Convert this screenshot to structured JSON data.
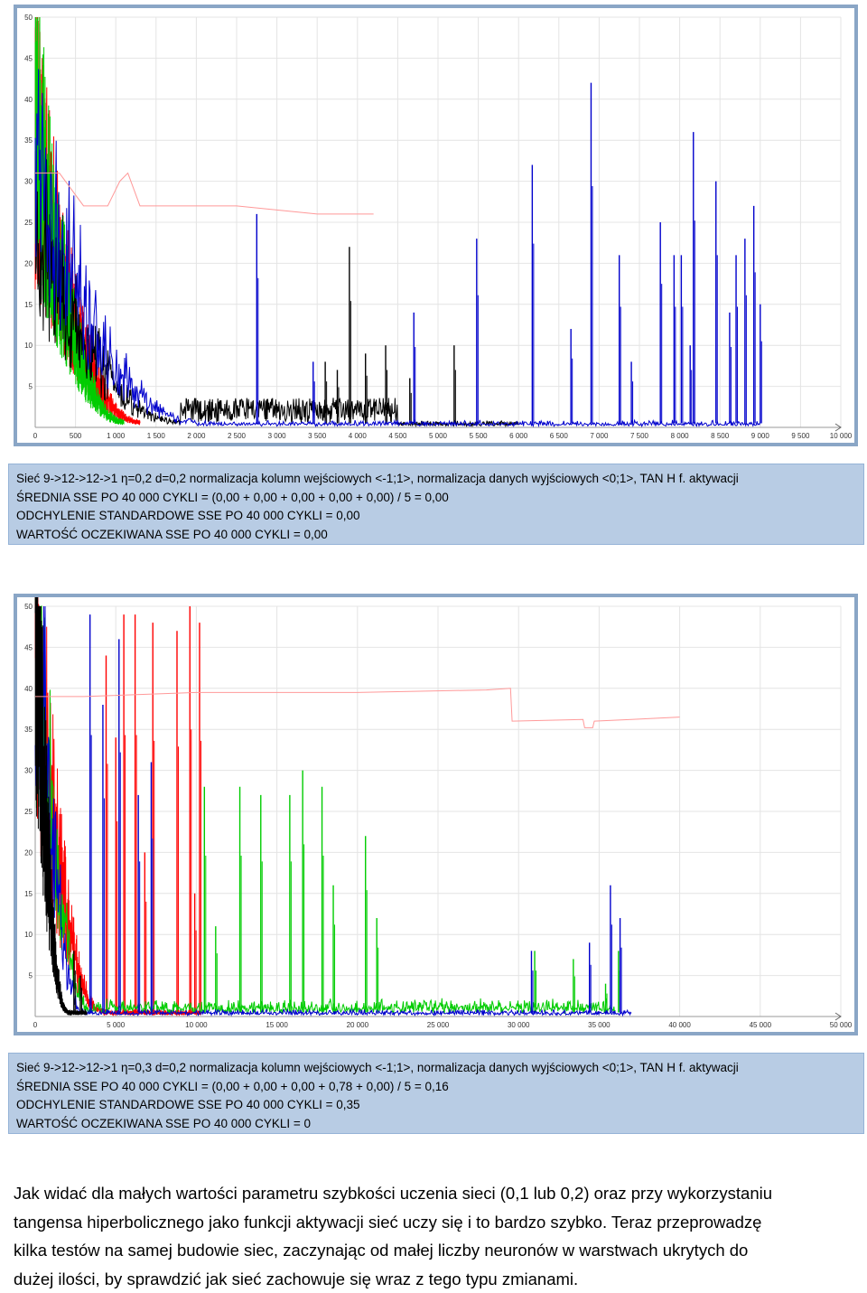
{
  "charts_meta": {
    "colors": {
      "frame": "#8aa6c6",
      "caption_bg": "#b8cce4",
      "grid": "#e4e4e4"
    }
  },
  "chart_data": [
    {
      "type": "line",
      "title": "",
      "xlabel": "",
      "ylabel": "",
      "xlim": [
        0,
        10000
      ],
      "ylim": [
        0,
        50
      ],
      "x_ticks": [
        "0",
        "500",
        "1 000",
        "1 500",
        "2 000",
        "2 500",
        "3 000",
        "3 500",
        "4 000",
        "4 500",
        "5 000",
        "5 500",
        "6 000",
        "6 500",
        "7 000",
        "7 500",
        "8 000",
        "8 500",
        "9 000",
        "9 500",
        "10 000"
      ],
      "y_ticks": [
        "5",
        "10",
        "15",
        "20",
        "25",
        "30",
        "35",
        "40",
        "45",
        "50"
      ],
      "grid": true,
      "series": [
        {
          "color": "#ff0000",
          "decay_end": 1300,
          "decay_start": 30,
          "last": 1300,
          "spikes": []
        },
        {
          "color": "#00cc00",
          "decay_end": 1100,
          "decay_start": 32,
          "last": 1100,
          "spikes": []
        },
        {
          "color": "#000000",
          "decay_end": 1800,
          "decay_start": 22,
          "last": 6000,
          "noise_mid": 3,
          "spikes": [
            [
              3900,
              22
            ],
            [
              4350,
              10
            ],
            [
              5200,
              10
            ],
            [
              3750,
              7
            ],
            [
              4650,
              6
            ],
            [
              3600,
              8
            ],
            [
              4100,
              9
            ]
          ]
        },
        {
          "color": "#0000cc",
          "decay_end": 2000,
          "decay_start": 28,
          "last": 9000,
          "spikes": [
            [
              2750,
              26
            ],
            [
              3450,
              8
            ],
            [
              4700,
              14
            ],
            [
              5480,
              23
            ],
            [
              6170,
              32
            ],
            [
              6650,
              12
            ],
            [
              6900,
              42
            ],
            [
              7250,
              21
            ],
            [
              7760,
              25
            ],
            [
              7930,
              21
            ],
            [
              8020,
              21
            ],
            [
              8170,
              36
            ],
            [
              8450,
              30
            ],
            [
              8700,
              21
            ],
            [
              8810,
              23
            ],
            [
              8920,
              27
            ],
            [
              9000,
              15
            ],
            [
              8620,
              14
            ],
            [
              8130,
              10
            ],
            [
              7400,
              8
            ]
          ]
        },
        {
          "color": "#ff9999",
          "line": [
            [
              0,
              31
            ],
            [
              300,
              31
            ],
            [
              600,
              27
            ],
            [
              900,
              27
            ],
            [
              1050,
              30
            ],
            [
              1150,
              31
            ],
            [
              1300,
              27
            ],
            [
              2500,
              27
            ],
            [
              3500,
              26
            ],
            [
              4200,
              26
            ]
          ]
        }
      ]
    },
    {
      "type": "line",
      "title": "",
      "xlabel": "",
      "ylabel": "",
      "xlim": [
        0,
        50000
      ],
      "ylim": [
        0,
        50
      ],
      "x_ticks": [
        "0",
        "5 000",
        "10 000",
        "15 000",
        "20 000",
        "25 000",
        "30 000",
        "35 000",
        "40 000",
        "45 000",
        "50 000"
      ],
      "y_ticks": [
        "5",
        "10",
        "15",
        "20",
        "25",
        "30",
        "35",
        "40",
        "45",
        "50"
      ],
      "grid": true,
      "series": [
        {
          "color": "#ff0000",
          "decay_end": 4200,
          "decay_start": 40,
          "last": 10300,
          "spikes": [
            [
              4400,
              44
            ],
            [
              5000,
              34
            ],
            [
              5500,
              49
            ],
            [
              6200,
              49
            ],
            [
              6800,
              20
            ],
            [
              7300,
              48
            ],
            [
              8800,
              47
            ],
            [
              9600,
              50
            ],
            [
              10200,
              48
            ],
            [
              9900,
              15
            ]
          ]
        },
        {
          "color": "#00cc00",
          "decay_end": 3600,
          "decay_start": 45,
          "last": 36000,
          "low_plateau": 1,
          "spikes": [
            [
              10500,
              28
            ],
            [
              11200,
              11
            ],
            [
              12700,
              28
            ],
            [
              14000,
              27
            ],
            [
              15800,
              27
            ],
            [
              16600,
              30
            ],
            [
              17800,
              28
            ],
            [
              18500,
              16
            ],
            [
              20500,
              22
            ],
            [
              21200,
              12
            ],
            [
              31000,
              8
            ],
            [
              33400,
              7
            ],
            [
              36200,
              8
            ],
            [
              35400,
              4
            ]
          ]
        },
        {
          "color": "#0000cc",
          "decay_end": 3000,
          "decay_start": 50,
          "last": 37000,
          "spikes": [
            [
              3400,
              49
            ],
            [
              4200,
              38
            ],
            [
              5200,
              46
            ],
            [
              6400,
              27
            ],
            [
              7200,
              31
            ],
            [
              30800,
              8
            ],
            [
              35700,
              16
            ],
            [
              36300,
              12
            ],
            [
              34400,
              9
            ]
          ]
        },
        {
          "color": "#000000",
          "decay_end": 2000,
          "decay_start": 48,
          "last": 3200,
          "spikes": [
            [
              2400,
              8
            ],
            [
              2800,
              5
            ]
          ]
        },
        {
          "color": "#ff9999",
          "line": [
            [
              0,
              39
            ],
            [
              3000,
              39
            ],
            [
              10000,
              39.5
            ],
            [
              20000,
              39.5
            ],
            [
              28000,
              39.8
            ],
            [
              29500,
              40
            ],
            [
              29600,
              36
            ],
            [
              34000,
              36.2
            ],
            [
              34100,
              35.2
            ],
            [
              34600,
              35.2
            ],
            [
              34700,
              36
            ],
            [
              37000,
              36.2
            ],
            [
              40000,
              36.5
            ]
          ]
        }
      ]
    }
  ],
  "captions": [
    {
      "line1": "Sieć 9->12->12->1    η=0,2 d=0,2 normalizacja kolumn wejściowych <-1;1>, normalizacja danych wyjściowych <0;1>, TAN H f. aktywacji",
      "line2": "ŚREDNIA SSE PO 40 000 CYKLI = (0,00 + 0,00 + 0,00 + 0,00 + 0,00) / 5 = 0,00",
      "line3": "ODCHYLENIE STANDARDOWE SSE PO 40 000 CYKLI = 0,00",
      "line4": "WARTOŚĆ OCZEKIWANA SSE PO 40 000 CYKLI = 0,00"
    },
    {
      "line1": "Sieć 9->12->12->1    η=0,3 d=0,2 normalizacja kolumn wejściowych <-1;1>, normalizacja danych wyjściowych <0;1>, TAN H f. aktywacji",
      "line2": "ŚREDNIA SSE PO 40 000 CYKLI = (0,00 + 0,00 + 0,00 + 0,78 + 0,00) / 5 = 0,16",
      "line3": "ODCHYLENIE STANDARDOWE SSE PO 40 000 CYKLI = 0,35",
      "line4": "WARTOŚĆ OCZEKIWANA SSE PO 40 000 CYKLI = 0"
    }
  ],
  "paragraph": {
    "l1": "Jak widać dla małych wartości parametru szybkości uczenia sieci (0,1 lub 0,2) oraz przy wykorzystaniu",
    "l2": "tangensa hiperbolicznego jako funkcji aktywacji sieć uczy się i to bardzo szybko. Teraz przeprowadzę",
    "l3": "kilka testów na samej budowie siec, zaczynając od małej liczby neuronów w warstwach ukrytych do",
    "l4": "dużej ilości, by sprawdzić jak sieć zachowuje się wraz z tego typu zmianami."
  }
}
